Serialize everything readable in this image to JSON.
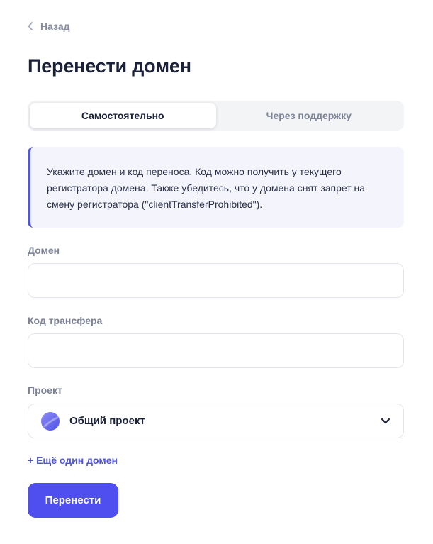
{
  "nav": {
    "back_label": "Назад"
  },
  "page": {
    "title": "Перенести домен"
  },
  "tabs": [
    {
      "label": "Самостоятельно",
      "active": true
    },
    {
      "label": "Через поддержку",
      "active": false
    }
  ],
  "info": {
    "text": "Укажите домен и код переноса. Код можно получить у текущего регистратора домена. Также убедитесь, что у домена снят запрет на смену регистратора (\"clientTransferProhibited\")."
  },
  "form": {
    "domain": {
      "label": "Домен",
      "value": "",
      "placeholder": ""
    },
    "transfer_code": {
      "label": "Код трансфера",
      "value": "",
      "placeholder": ""
    },
    "project": {
      "label": "Проект",
      "selected": "Общий проект",
      "icon": "project-avatar-icon"
    },
    "add_domain_label": "+ Ещё один домен",
    "submit_label": "Перенести"
  },
  "colors": {
    "accent": "#4f4ff0",
    "info_border": "#4f55e0",
    "info_bg": "#f4f5fc",
    "muted_text": "#7d8397",
    "heading": "#1b2138"
  }
}
